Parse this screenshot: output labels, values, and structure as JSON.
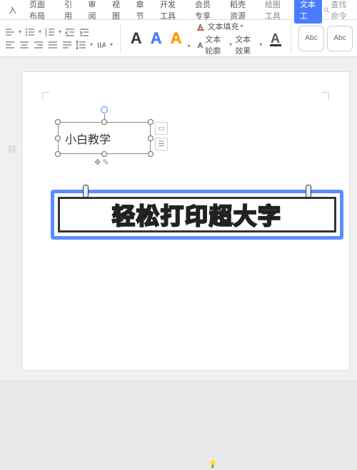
{
  "tabs": {
    "items": [
      "入",
      "页面布局",
      "引用",
      "审阅",
      "视图",
      "章节",
      "开发工具",
      "会员专享",
      "稻壳资源"
    ],
    "context": "绘图工具",
    "highlight": "文本工",
    "search_placeholder": "查找命令"
  },
  "toolbar": {
    "style_a1": "A",
    "style_a2": "A",
    "style_a3": "A",
    "text_fill": "文本填充",
    "text_outline": "文本轮廓",
    "text_effect": "文本效果",
    "abc1": "Abc",
    "abc2": "Abc"
  },
  "textbox": {
    "content": "小白教学"
  },
  "banner": {
    "text": "轻松打印超大字"
  },
  "icons": {
    "search": "search-icon",
    "bulb": "💡"
  }
}
